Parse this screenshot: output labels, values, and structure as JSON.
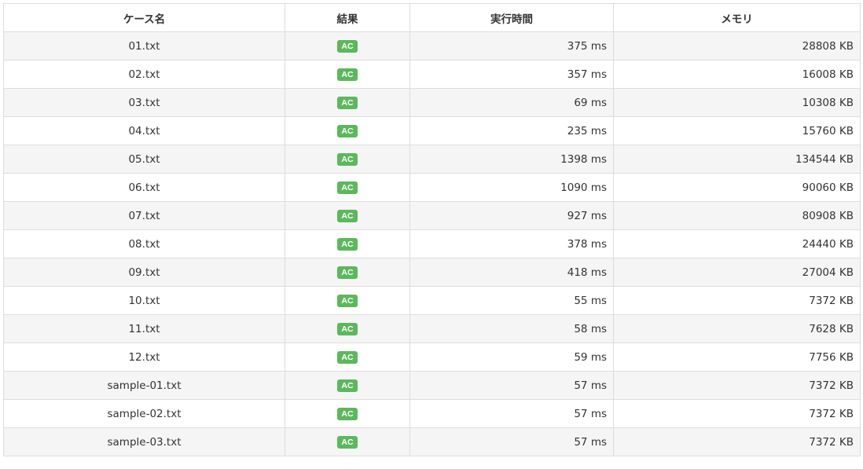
{
  "headers": {
    "case_name": "ケース名",
    "result": "結果",
    "exec_time": "実行時間",
    "memory": "メモリ"
  },
  "colors": {
    "ac_badge": "#5cb85c",
    "stripe": "#f5f5f5",
    "border": "#dddddd"
  },
  "rows": [
    {
      "name": "01.txt",
      "result": "AC",
      "time": "375 ms",
      "memory": "28808 KB"
    },
    {
      "name": "02.txt",
      "result": "AC",
      "time": "357 ms",
      "memory": "16008 KB"
    },
    {
      "name": "03.txt",
      "result": "AC",
      "time": "69 ms",
      "memory": "10308 KB"
    },
    {
      "name": "04.txt",
      "result": "AC",
      "time": "235 ms",
      "memory": "15760 KB"
    },
    {
      "name": "05.txt",
      "result": "AC",
      "time": "1398 ms",
      "memory": "134544 KB"
    },
    {
      "name": "06.txt",
      "result": "AC",
      "time": "1090 ms",
      "memory": "90060 KB"
    },
    {
      "name": "07.txt",
      "result": "AC",
      "time": "927 ms",
      "memory": "80908 KB"
    },
    {
      "name": "08.txt",
      "result": "AC",
      "time": "378 ms",
      "memory": "24440 KB"
    },
    {
      "name": "09.txt",
      "result": "AC",
      "time": "418 ms",
      "memory": "27004 KB"
    },
    {
      "name": "10.txt",
      "result": "AC",
      "time": "55 ms",
      "memory": "7372 KB"
    },
    {
      "name": "11.txt",
      "result": "AC",
      "time": "58 ms",
      "memory": "7628 KB"
    },
    {
      "name": "12.txt",
      "result": "AC",
      "time": "59 ms",
      "memory": "7756 KB"
    },
    {
      "name": "sample-01.txt",
      "result": "AC",
      "time": "57 ms",
      "memory": "7372 KB"
    },
    {
      "name": "sample-02.txt",
      "result": "AC",
      "time": "57 ms",
      "memory": "7372 KB"
    },
    {
      "name": "sample-03.txt",
      "result": "AC",
      "time": "57 ms",
      "memory": "7372 KB"
    }
  ]
}
